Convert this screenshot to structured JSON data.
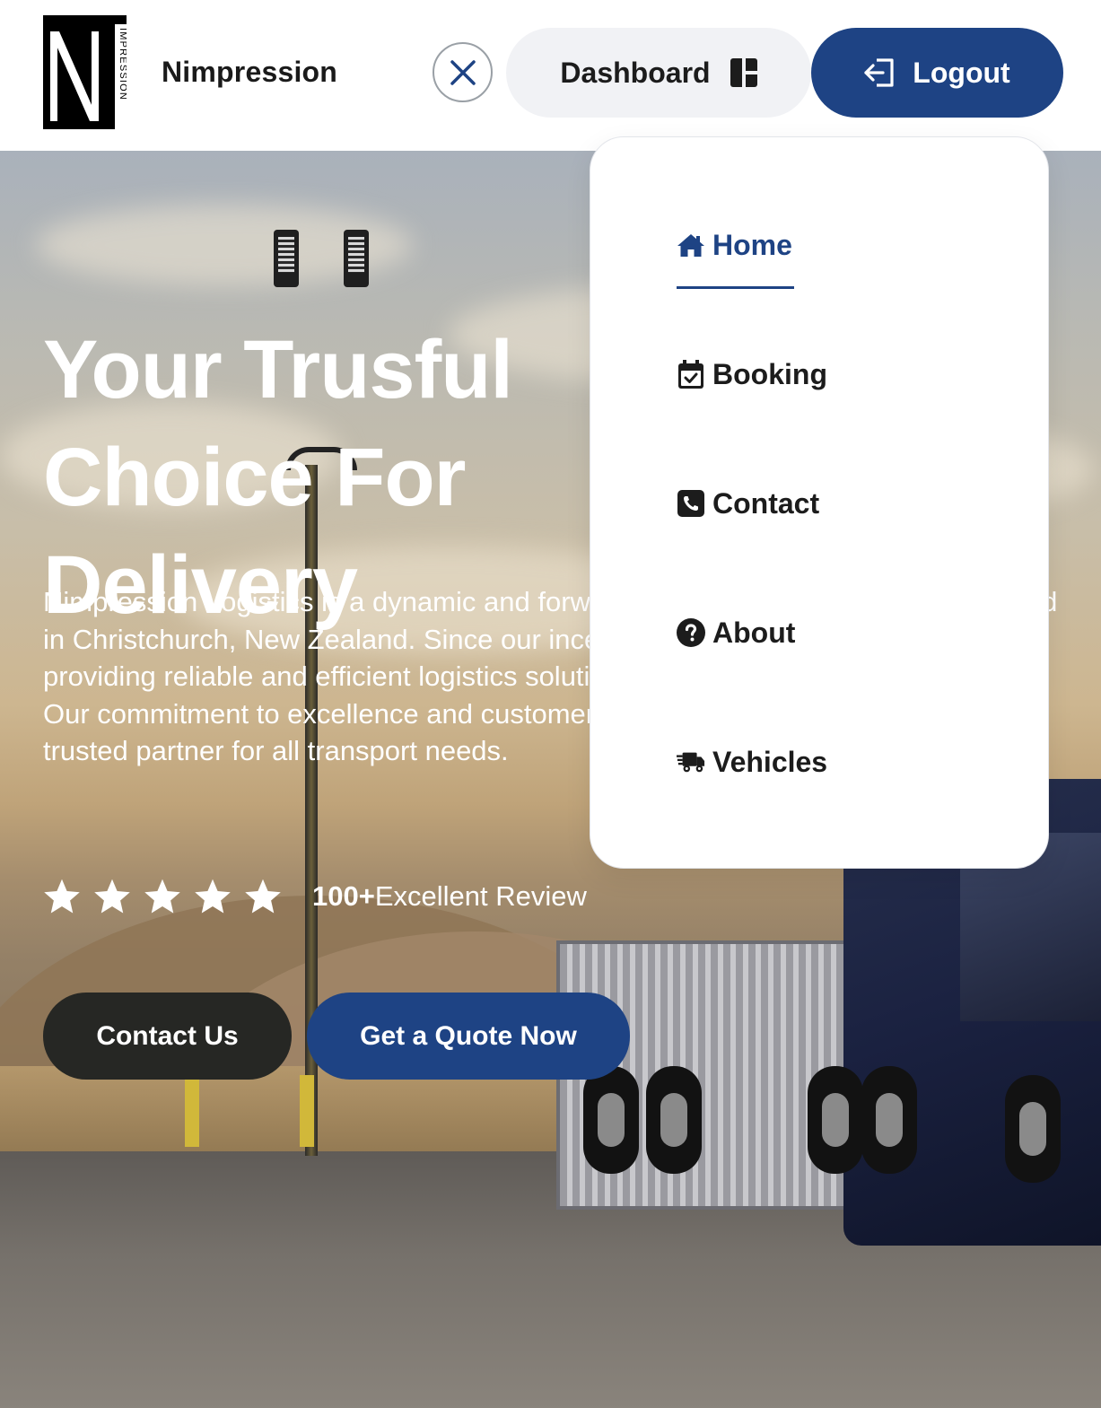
{
  "brand": {
    "logo_letters": "NI",
    "logo_vertical_text": "IMPRESSION",
    "name": "Nimpression"
  },
  "header": {
    "close_icon": "x-icon",
    "dashboard_label": "Dashboard",
    "dashboard_icon": "layout-dashboard-icon",
    "logout_label": "Logout",
    "logout_icon": "login-arrow-icon"
  },
  "menu": {
    "items": [
      {
        "label": "Home",
        "icon": "house-icon",
        "active": true
      },
      {
        "label": "Booking",
        "icon": "calendar-check-icon",
        "active": false
      },
      {
        "label": "Contact",
        "icon": "phone-square-icon",
        "active": false
      },
      {
        "label": "About",
        "icon": "question-circle-icon",
        "active": false
      },
      {
        "label": "Vehicles",
        "icon": "truck-fast-icon",
        "active": false
      }
    ]
  },
  "hero": {
    "title": "Your Trusful Choice For Delivery",
    "description": "Nimpression Logistics is a dynamic and forward-thinking transport company based in Christchurch, New Zealand. Since our inception, we have been dedicated to providing reliable and efficient logistics solutions to businesses across the region. Our commitment to excellence and customer satisfaction has positioned us as a trusted partner for all transport needs.",
    "rating": {
      "stars": 5,
      "count": "100+",
      "label": "Excellent Review"
    },
    "contact_button": "Contact Us",
    "quote_button": "Get a Quote Now"
  },
  "colors": {
    "primary": "#1e4384",
    "dark_button": "#262724",
    "dashboard_bg": "#f1f2f5",
    "white": "#ffffff"
  }
}
